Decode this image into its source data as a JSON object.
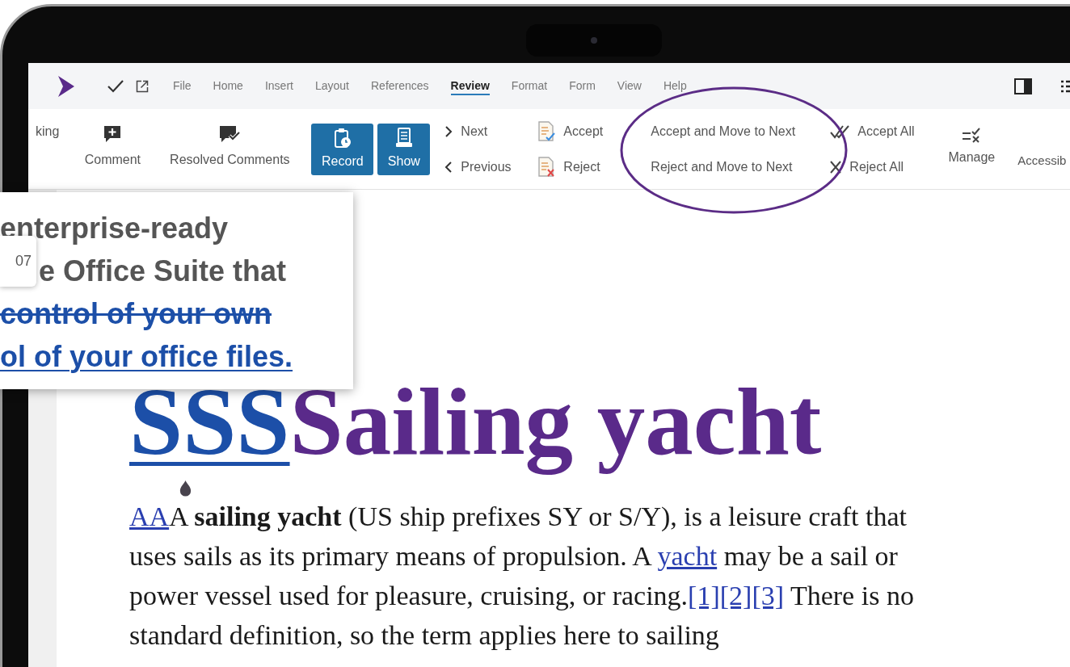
{
  "menu": {
    "tabs": [
      {
        "label": "File",
        "selected": false
      },
      {
        "label": "Home",
        "selected": false
      },
      {
        "label": "Insert",
        "selected": false
      },
      {
        "label": "Layout",
        "selected": false
      },
      {
        "label": "References",
        "selected": false
      },
      {
        "label": "Review",
        "selected": true
      },
      {
        "label": "Format",
        "selected": false
      },
      {
        "label": "Form",
        "selected": false
      },
      {
        "label": "View",
        "selected": false
      },
      {
        "label": "Help",
        "selected": false
      }
    ]
  },
  "ribbon": {
    "section_label": "king",
    "comment": "Comment",
    "resolved_comments": "Resolved Comments",
    "toggles": [
      {
        "label": "Record",
        "on": true
      },
      {
        "label": "Show",
        "on": true
      }
    ],
    "next": "Next",
    "previous": "Previous",
    "accept": "Accept",
    "reject": "Reject",
    "accept_and_move": "Accept and Move to Next",
    "reject_and_move": "Reject and Move to Next",
    "accept_all": "Accept All",
    "reject_all": "Reject All",
    "manage": "Manage",
    "cut_label": "Accessib"
  },
  "magnifier": {
    "badge": "07",
    "lines": [
      {
        "text": "enterprise-ready",
        "kind": "plain"
      },
      {
        "text": "e Office Suite that",
        "kind": "plain"
      },
      {
        "text": "control of your own",
        "kind": "deleted"
      },
      {
        "text": "ol of your office files.",
        "kind": "inserted"
      }
    ]
  },
  "document": {
    "heading": [
      {
        "text": "SSS",
        "kind": "inserted"
      },
      {
        "text": "Sailing yacht",
        "kind": "plain"
      }
    ],
    "paragraph": [
      {
        "text": "AA",
        "kind": "link"
      },
      {
        "text": "A ",
        "kind": "plain"
      },
      {
        "text": "sailing yacht",
        "kind": "bold"
      },
      {
        "text": " (US ship prefixes SY or S/Y), is a leisure craft that uses sails as its primary means of propulsion. A ",
        "kind": "plain"
      },
      {
        "text": "yacht",
        "kind": "link"
      },
      {
        "text": " may be a sail or power vessel used for pleasure, cruising, or racing.",
        "kind": "plain"
      },
      {
        "text": "[1][2][3]",
        "kind": "link"
      },
      {
        "text": " There is no standard definition, so the term applies here to sailing",
        "kind": "plain"
      }
    ]
  }
}
